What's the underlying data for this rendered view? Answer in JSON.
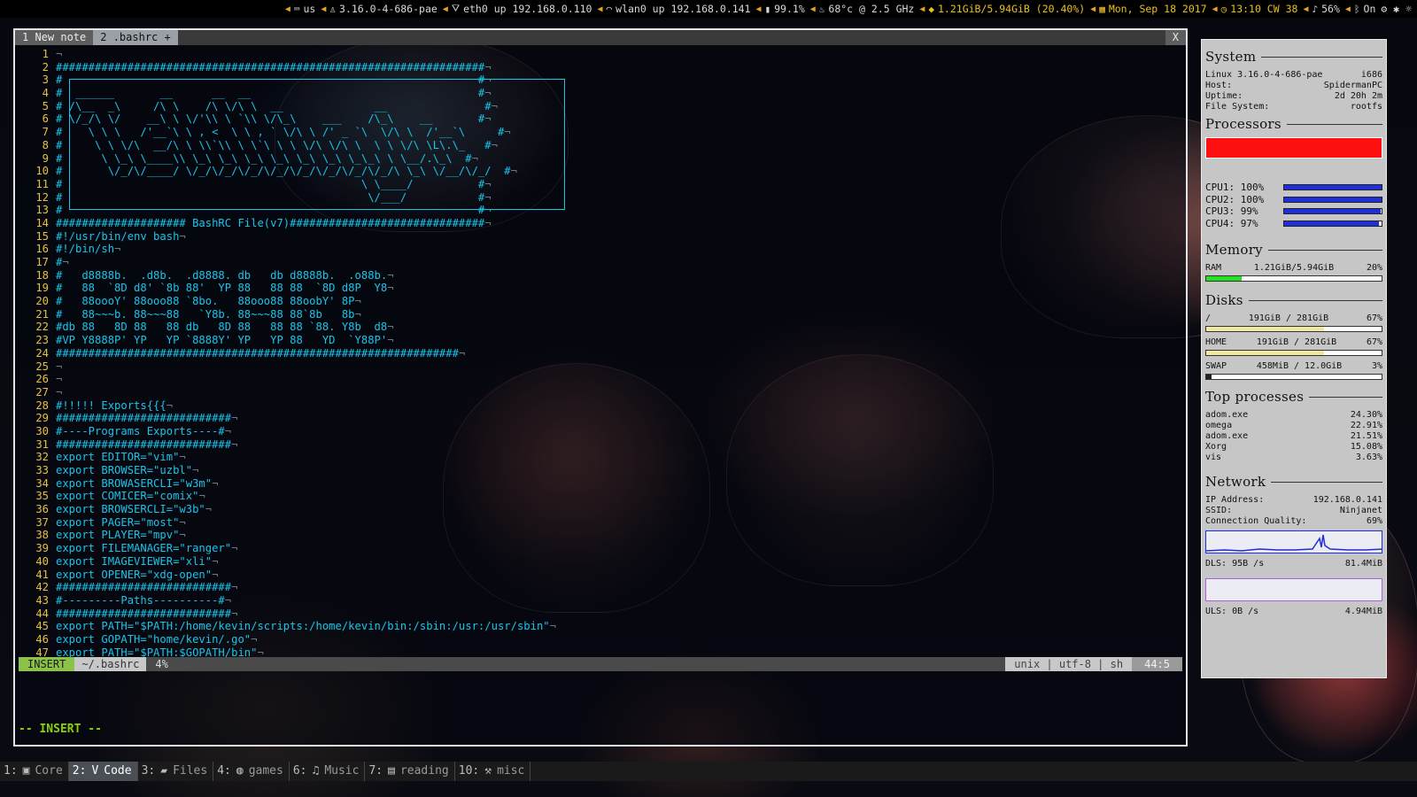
{
  "topbar": {
    "segments": [
      {
        "icon": "keyboard-icon",
        "text": "us"
      },
      {
        "icon": "linux-icon",
        "text": "3.16.0-4-686-pae"
      },
      {
        "icon": "ethernet-icon",
        "text": "eth0 up 192.168.0.110"
      },
      {
        "icon": "wifi-icon",
        "text": "wlan0 up 192.168.0.141"
      },
      {
        "icon": "battery-icon",
        "text": "99.1%"
      },
      {
        "icon": "cpu-temp-icon",
        "text": "68°c @ 2.5 GHz"
      },
      {
        "icon": "memory-icon",
        "text": "1.21GiB/5.94GiB (20.40%)"
      },
      {
        "icon": "calendar-icon",
        "text": "Mon, Sep 18 2017"
      },
      {
        "icon": "clock-icon",
        "text": "13:10 CW 38"
      },
      {
        "icon": "volume-icon",
        "text": "56%"
      },
      {
        "icon": "bluetooth-icon",
        "text": "On"
      }
    ]
  },
  "vim": {
    "tabs": [
      {
        "label": "1 New note",
        "active": false
      },
      {
        "label": "2 .bashrc +",
        "active": true
      }
    ],
    "close_label": "X",
    "lines": [
      {
        "n": "1",
        "t": ""
      },
      {
        "n": "2",
        "t": "##################################################################"
      },
      {
        "n": "3",
        "t": "#                                                                #"
      },
      {
        "n": "4",
        "t": "#  ______       __      __  __                                   #"
      },
      {
        "n": "5",
        "t": "# /\\__  _\\     /\\ \\    /\\ \\/\\ \\  __              __               #"
      },
      {
        "n": "6",
        "t": "# \\/_/\\ \\/    __\\ \\ \\/'\\\\ \\ `\\\\ \\/\\_\\    ___    /\\_\\    __       #"
      },
      {
        "n": "7",
        "t": "#    \\ \\ \\   /'__`\\ \\ , <  \\ \\ , ` \\/\\ \\ /' _ `\\  \\/\\ \\  /'__`\\     #"
      },
      {
        "n": "8",
        "t": "#     \\ \\ \\/\\  __/\\ \\ \\\\`\\\\ \\ \\`\\ \\ \\ \\/\\ \\/\\ \\  \\ \\ \\/\\ \\L\\.\\_   #"
      },
      {
        "n": "9",
        "t": "#      \\ \\_\\ \\____\\\\ \\_\\ \\_\\ \\_\\ \\_\\ \\_\\ \\_\\ \\_\\_\\ \\ \\__/.\\_\\  #"
      },
      {
        "n": "10",
        "t": "#       \\/_/\\/____/ \\/_/\\/_/\\/_/\\/_/\\/_/\\/_/\\/_/\\/_/\\ \\_\\ \\/__/\\/_/  #"
      },
      {
        "n": "11",
        "t": "#                                              \\ \\____/          #"
      },
      {
        "n": "12",
        "t": "#                                               \\/___/           #"
      },
      {
        "n": "13",
        "t": "#                                                                #"
      },
      {
        "n": "14",
        "t": "#################### BashRC File(v7)##############################"
      },
      {
        "n": "15",
        "t": "#!/usr/bin/env bash"
      },
      {
        "n": "16",
        "t": "#!/bin/sh"
      },
      {
        "n": "17",
        "t": "#"
      },
      {
        "n": "18",
        "t": "#   d8888b.  .d8b.  .d8888. db   db d8888b.  .o88b."
      },
      {
        "n": "19",
        "t": "#   88  `8D d8' `8b 88'  YP 88   88 88  `8D d8P  Y8"
      },
      {
        "n": "20",
        "t": "#   88oooY' 88ooo88 `8bo.   88ooo88 88oobY' 8P"
      },
      {
        "n": "21",
        "t": "#   88~~~b. 88~~~88   `Y8b. 88~~~88 88`8b   8b"
      },
      {
        "n": "22",
        "t": "#db 88   8D 88   88 db   8D 88   88 88 `88. Y8b  d8"
      },
      {
        "n": "23",
        "t": "#VP Y8888P' YP   YP `8888Y' YP   YP 88   YD  `Y88P'"
      },
      {
        "n": "24",
        "t": "##############################################################"
      },
      {
        "n": "25",
        "t": ""
      },
      {
        "n": "26",
        "t": ""
      },
      {
        "n": "27",
        "t": ""
      },
      {
        "n": "28",
        "t": "#!!!!! Exports{{{"
      },
      {
        "n": "29",
        "t": "###########################"
      },
      {
        "n": "30",
        "t": "#----Programs Exports----#"
      },
      {
        "n": "31",
        "t": "###########################"
      },
      {
        "n": "32",
        "t": "export EDITOR=\"vim\""
      },
      {
        "n": "33",
        "t": "export BROWSER=\"uzbl\""
      },
      {
        "n": "34",
        "t": "export BROWASERCLI=\"w3m\""
      },
      {
        "n": "35",
        "t": "export COMICER=\"comix\""
      },
      {
        "n": "36",
        "t": "export BROWSERCLI=\"w3b\""
      },
      {
        "n": "37",
        "t": "export PAGER=\"most\""
      },
      {
        "n": "38",
        "t": "export PLAYER=\"mpv\""
      },
      {
        "n": "39",
        "t": "export FILEMANAGER=\"ranger\""
      },
      {
        "n": "40",
        "t": "export IMAGEVIEWER=\"xli\""
      },
      {
        "n": "41",
        "t": "export OPENER=\"xdg-open\""
      },
      {
        "n": "42",
        "t": "###########################"
      },
      {
        "n": "43",
        "t": "#---------Paths----------#"
      },
      {
        "n": "44",
        "t": "###########################"
      },
      {
        "n": "45",
        "t": "export PATH=\"$PATH:/home/kevin/scripts:/home/kevin/bin:/sbin:/usr:/usr/sbin\""
      },
      {
        "n": "46",
        "t": "export GOPATH=\"home/kevin/.go\""
      },
      {
        "n": "47",
        "t": "export PATH=\"$PATH:$GOPATH/bin\""
      }
    ],
    "statusline": {
      "mode": "INSERT",
      "file": "~/.bashrc",
      "percent": "4%",
      "info": "unix | utf-8 | sh",
      "position": "44:5"
    },
    "cmdline": "-- INSERT --"
  },
  "conky": {
    "system": {
      "title": "System",
      "rows": [
        {
          "k": "Linux 3.16.0-4-686-pae",
          "v": "i686"
        },
        {
          "k": "Host:",
          "v": "SpidermanPC"
        },
        {
          "k": "Uptime:",
          "v": "2d 20h 2m"
        },
        {
          "k": "File System:",
          "v": "rootfs"
        }
      ]
    },
    "processors": {
      "title": "Processors",
      "cpus": [
        {
          "label": "CPU1: 100%",
          "value": 100
        },
        {
          "label": "CPU2: 100%",
          "value": 100
        },
        {
          "label": "CPU3: 99%",
          "value": 99
        },
        {
          "label": "CPU4: 97%",
          "value": 97
        }
      ],
      "graph_color": "#ff1010",
      "bar_color": "#1f2fd8"
    },
    "memory": {
      "title": "Memory",
      "label": "RAM",
      "value": "1.21GiB/5.94GiB",
      "percent": "20%",
      "fraction": 0.2,
      "bar_color": "#22e022"
    },
    "disks": {
      "title": "Disks",
      "rows": [
        {
          "name": "/",
          "value": "191GiB / 281GiB",
          "percent": "67%",
          "fraction": 0.67,
          "color": "#f0e8a0"
        },
        {
          "name": "HOME",
          "value": "191GiB / 281GiB",
          "percent": "67%",
          "fraction": 0.67,
          "color": "#f0e8a0"
        },
        {
          "name": "SWAP",
          "value": "458MiB / 12.0GiB",
          "percent": "3%",
          "fraction": 0.03,
          "color": "#222222"
        }
      ]
    },
    "top": {
      "title": "Top processes",
      "rows": [
        {
          "name": "adom.exe",
          "value": "24.30%"
        },
        {
          "name": "omega",
          "value": "22.91%"
        },
        {
          "name": "adom.exe",
          "value": "21.51%"
        },
        {
          "name": "Xorg",
          "value": "15.08%"
        },
        {
          "name": "vis",
          "value": "3.63%"
        }
      ]
    },
    "network": {
      "title": "Network",
      "rows": [
        {
          "k": "IP Address:",
          "v": "192.168.0.141"
        },
        {
          "k": "SSID:",
          "v": "Ninjanet"
        },
        {
          "k": "Connection Quality:",
          "v": "69%"
        }
      ],
      "download": {
        "label": "DLS: 95B  /s",
        "total": "81.4MiB",
        "color": "#1f2fd8"
      },
      "upload": {
        "label": "ULS: 0B  /s",
        "total": "4.94MiB",
        "color": "#b060d8"
      }
    }
  },
  "workspaces": [
    {
      "num": "1:",
      "icon": "terminal-icon",
      "glyph": "▣",
      "label": "Core",
      "active": false
    },
    {
      "num": "2:",
      "icon": "vim-icon",
      "glyph": "V",
      "label": "Code",
      "active": true
    },
    {
      "num": "3:",
      "icon": "folder-icon",
      "glyph": "▰",
      "label": "Files",
      "active": false
    },
    {
      "num": "4:",
      "icon": "gamepad-icon",
      "glyph": "◍",
      "label": "games",
      "active": false
    },
    {
      "num": "6:",
      "icon": "headphones-icon",
      "glyph": "♫",
      "label": "Music",
      "active": false
    },
    {
      "num": "7:",
      "icon": "document-icon",
      "glyph": "▤",
      "label": "reading",
      "active": false
    },
    {
      "num": "10:",
      "icon": "misc-icon",
      "glyph": "⚒",
      "label": "misc",
      "active": false
    }
  ]
}
